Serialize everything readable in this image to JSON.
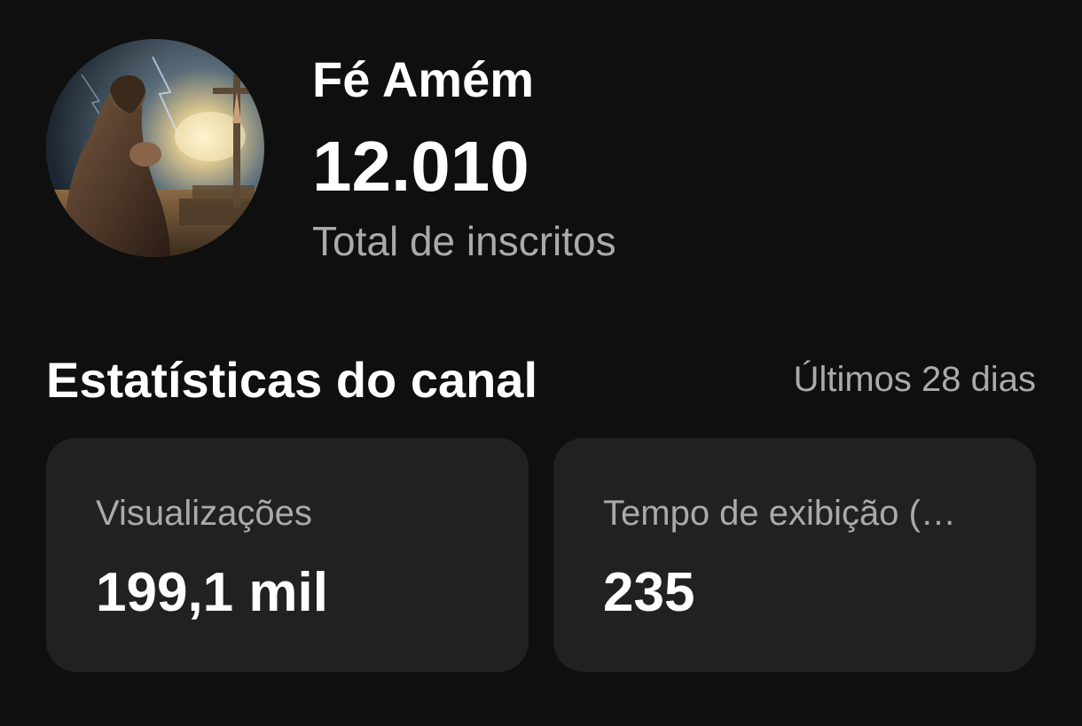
{
  "channel": {
    "name": "Fé Amém",
    "subscriber_count": "12.010",
    "subscriber_label": "Total de inscritos",
    "avatar_icon": "channel-avatar-praying-figure-cross"
  },
  "stats": {
    "title": "Estatísticas do canal",
    "period": "Últimos 28 dias",
    "cards": [
      {
        "label": "Visualizações",
        "value": "199,1 mil"
      },
      {
        "label": "Tempo de exibição (…",
        "value": "235"
      }
    ]
  },
  "colors": {
    "background": "#0f0f0f",
    "card": "#212121",
    "text_primary": "#ffffff",
    "text_secondary": "#aaaaaa"
  }
}
